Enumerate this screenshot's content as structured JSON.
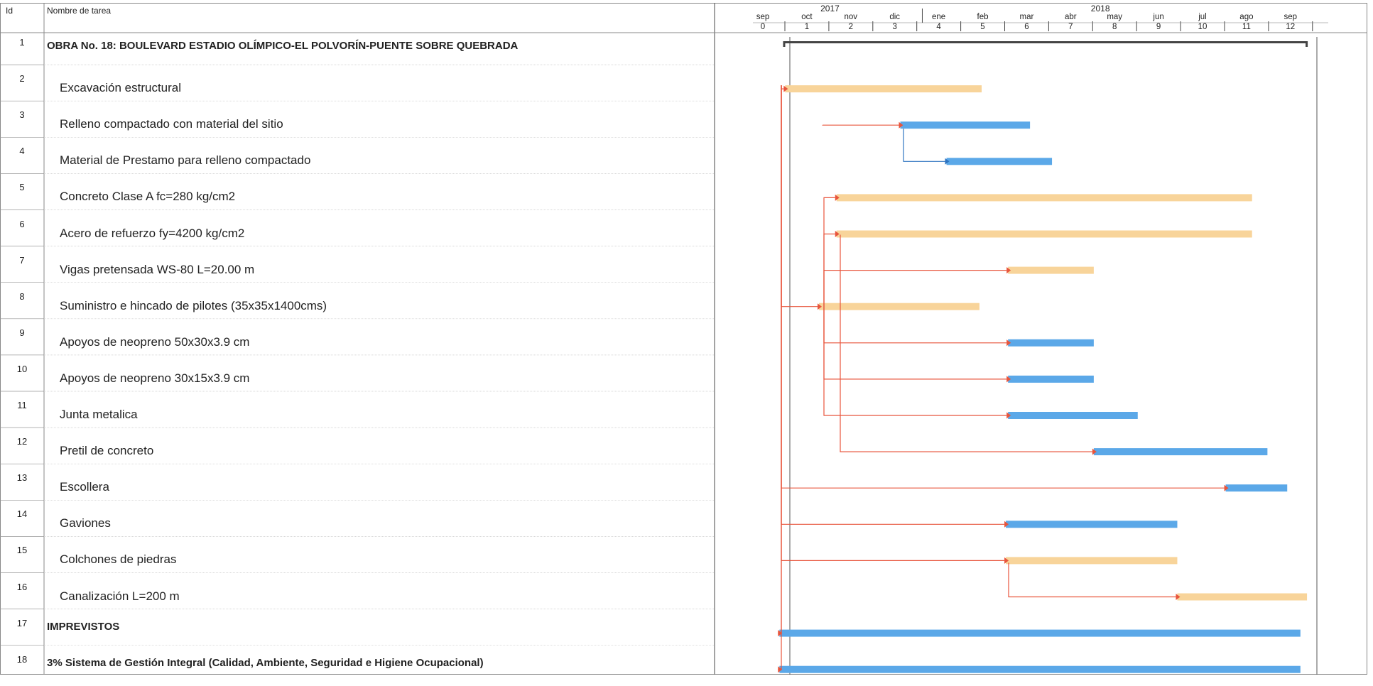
{
  "table": {
    "id_header": "Id",
    "name_header": "Nombre de tarea"
  },
  "timeline": {
    "years": [
      "2017",
      "2018"
    ],
    "months": [
      {
        "label": "sep",
        "index": "0"
      },
      {
        "label": "oct",
        "index": "1"
      },
      {
        "label": "nov",
        "index": "2"
      },
      {
        "label": "dic",
        "index": "3"
      },
      {
        "label": "ene",
        "index": "4"
      },
      {
        "label": "feb",
        "index": "5"
      },
      {
        "label": "mar",
        "index": "6"
      },
      {
        "label": "abr",
        "index": "7"
      },
      {
        "label": "may",
        "index": "8"
      },
      {
        "label": "jun",
        "index": "9"
      },
      {
        "label": "jul",
        "index": "10"
      },
      {
        "label": "ago",
        "index": "11"
      },
      {
        "label": "sep",
        "index": "12"
      }
    ]
  },
  "colors": {
    "critical": "#f8d49a",
    "normal": "#5ba8e8",
    "summary": "#444444",
    "link_red": "#e8553c",
    "link_blue": "#2f74c0",
    "rule": "#cccccc"
  },
  "chart_data": {
    "type": "gantt",
    "x_unit": "months from Sep 2017",
    "xlim": [
      0,
      12.3
    ],
    "tasks": [
      {
        "id": "1",
        "name": "OBRA No. 18: BOULEVARD ESTADIO OLÍMPICO-EL POLVORÍN-PUENTE SOBRE QUEBRADA",
        "kind": "summary",
        "start": 0.25,
        "end": 12.15
      },
      {
        "id": "2",
        "name": "Excavación estructural",
        "kind": "critical",
        "start": 0.28,
        "end": 4.75
      },
      {
        "id": "3",
        "name": "Relleno compactado con material del sitio",
        "kind": "normal",
        "start": 2.9,
        "end": 5.85
      },
      {
        "id": "4",
        "name": "Material de Prestamo para relleno compactado",
        "kind": "normal",
        "start": 3.95,
        "end": 6.35
      },
      {
        "id": "5",
        "name": "Concreto Clase A fc=280 kg/cm2",
        "kind": "critical",
        "start": 1.45,
        "end": 10.9
      },
      {
        "id": "6",
        "name": "Acero de refuerzo fy=4200 kg/cm2",
        "kind": "critical",
        "start": 1.45,
        "end": 10.9
      },
      {
        "id": "7",
        "name": "Vigas pretensada WS-80 L=20.00 m",
        "kind": "critical",
        "start": 5.35,
        "end": 7.3
      },
      {
        "id": "8",
        "name": "Suministro e hincado de pilotes (35x35x1400cms)",
        "kind": "critical",
        "start": 1.05,
        "end": 4.7
      },
      {
        "id": "9",
        "name": "Apoyos de neopreno 50x30x3.9 cm",
        "kind": "normal",
        "start": 5.35,
        "end": 7.3
      },
      {
        "id": "10",
        "name": "Apoyos de neopreno 30x15x3.9 cm",
        "kind": "normal",
        "start": 5.35,
        "end": 7.3
      },
      {
        "id": "11",
        "name": "Junta metalica",
        "kind": "normal",
        "start": 5.35,
        "end": 8.3
      },
      {
        "id": "12",
        "name": "Pretil de concreto",
        "kind": "normal",
        "start": 7.3,
        "end": 11.25
      },
      {
        "id": "13",
        "name": "Escollera",
        "kind": "normal",
        "start": 10.3,
        "end": 11.7
      },
      {
        "id": "14",
        "name": "Gaviones",
        "kind": "normal",
        "start": 5.3,
        "end": 9.2
      },
      {
        "id": "15",
        "name": "Colchones de piedras",
        "kind": "critical",
        "start": 5.3,
        "end": 9.2
      },
      {
        "id": "16",
        "name": "Canalización L=200 m",
        "kind": "critical",
        "start": 9.2,
        "end": 12.15
      },
      {
        "id": "17",
        "name": "IMPREVISTOS",
        "kind": "normal",
        "start": 0.15,
        "end": 12.0
      },
      {
        "id": "18",
        "name": "3% Sistema de Gestión Integral (Calidad, Ambiente, Seguridad e Higiene Ocupacional)",
        "kind": "normal",
        "start": 0.15,
        "end": 12.0
      }
    ],
    "links": [
      {
        "from": "1",
        "to": "2",
        "color": "red"
      },
      {
        "from": "2",
        "to": "3",
        "color": "red"
      },
      {
        "from": "3",
        "to": "4",
        "color": "blue"
      },
      {
        "from": "8",
        "to": "5",
        "color": "red"
      },
      {
        "from": "8",
        "to": "6",
        "color": "red"
      },
      {
        "from": "8",
        "to": "7",
        "color": "red"
      },
      {
        "from": "1",
        "to": "8",
        "color": "red"
      },
      {
        "from": "8",
        "to": "9",
        "color": "red"
      },
      {
        "from": "8",
        "to": "10",
        "color": "red"
      },
      {
        "from": "8",
        "to": "11",
        "color": "red"
      },
      {
        "from": "6",
        "to": "12",
        "color": "red"
      },
      {
        "from": "1",
        "to": "13",
        "color": "red"
      },
      {
        "from": "1",
        "to": "14",
        "color": "red"
      },
      {
        "from": "1",
        "to": "15",
        "color": "red"
      },
      {
        "from": "15",
        "to": "16",
        "color": "red"
      },
      {
        "from": "1",
        "to": "17",
        "color": "red"
      },
      {
        "from": "1",
        "to": "18",
        "color": "red"
      }
    ]
  }
}
